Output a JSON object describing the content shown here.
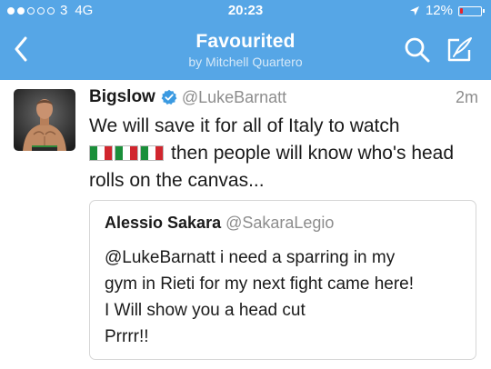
{
  "status_bar": {
    "signal_full": 2,
    "signal_total": 5,
    "carrier": "3",
    "network": "4G",
    "time": "20:23",
    "battery_text": "12%",
    "battery_level": 0.12,
    "battery_color": "#e8232a"
  },
  "nav": {
    "back_icon": "chevron-left-icon",
    "title": "Favourited",
    "subtitle": "by Mitchell Quartero",
    "search_icon": "search-icon",
    "compose_icon": "compose-icon",
    "bar_color": "#56a6e6"
  },
  "tweet": {
    "display_name": "Bigslow",
    "handle": "@LukeBarnatt",
    "time": "2m",
    "verified": true,
    "text_line1": "We will save it for all of Italy to watch",
    "flag_count": 3,
    "flag_emoji": "🇮🇹",
    "text_after_flags": "then people will know who's head",
    "text_line3": "rolls on the canvas...",
    "quoted": {
      "display_name": "Alessio Sakara",
      "handle": "@SakaraLegio",
      "lines": [
        "@LukeBarnatt i need a sparring in my",
        "gym in Rieti for my next fight came here!",
        "I Will show you a head cut",
        "Prrrr!!"
      ]
    }
  }
}
